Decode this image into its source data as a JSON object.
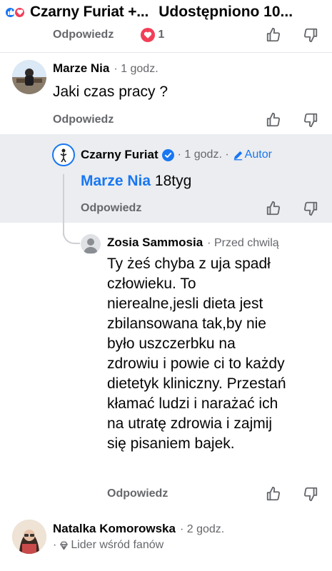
{
  "header": {
    "title": "Czarny Furiat +...",
    "subtitle": "Udostępniono 10...",
    "reply_label": "Odpowiedz",
    "reaction_count": "1"
  },
  "comments": [
    {
      "name": "Marze Nia",
      "time": "· 1 godz.",
      "text": "Jaki czas pracy ?",
      "reply_label": "Odpowiedz"
    },
    {
      "name": "Czarny Furiat",
      "time": "· 1 godz. ·",
      "author_label": "Autor",
      "mention": "Marze Nia",
      "text": "18tyg",
      "reply_label": "Odpowiedz"
    },
    {
      "name": "Zosia Sammosia",
      "time": "· Przed chwilą",
      "lines": [
        "Ty żeś chyba z uja spadł",
        "człowieku. To",
        "nierealne,jesli dieta jest",
        "zbilansowana tak,by nie",
        "było uszczerbku na",
        "zdrowiu i powie ci to każdy",
        "dietetyk kliniczny. Przestań",
        "kłamać ludzi i narażać ich",
        "na utratę zdrowia i zajmij",
        "się pisaniem bajek."
      ],
      "reply_label": "Odpowiedz"
    },
    {
      "name": "Natalka Komorowska",
      "time": "· 2 godz.",
      "badge": "Lider wśród fanów"
    }
  ],
  "colors": {
    "link_blue": "#1877f2",
    "muted": "#65676b",
    "highlight_bg": "#ebedf0",
    "love_red": "#f33e58"
  }
}
